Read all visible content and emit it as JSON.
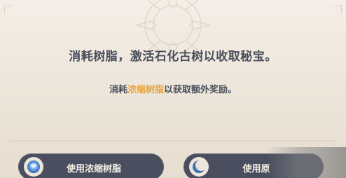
{
  "dialog": {
    "main_message": "消耗树脂，激活石化古树以收取秘宝。",
    "sub_prefix": "消耗",
    "sub_highlight": "浓缩树脂",
    "sub_suffix": "以获取额外奖励。",
    "highlight_color": "#e8a23a"
  },
  "buttons": {
    "left": {
      "label": "使用浓缩树脂",
      "icon": "condensed-resin-icon"
    },
    "right": {
      "label": "使用原",
      "icon": "original-resin-moon-icon"
    }
  },
  "colors": {
    "button_bg": "#4a4e5e",
    "text_dark": "#4a4f5d",
    "panel_bg": "#f3eee7"
  }
}
